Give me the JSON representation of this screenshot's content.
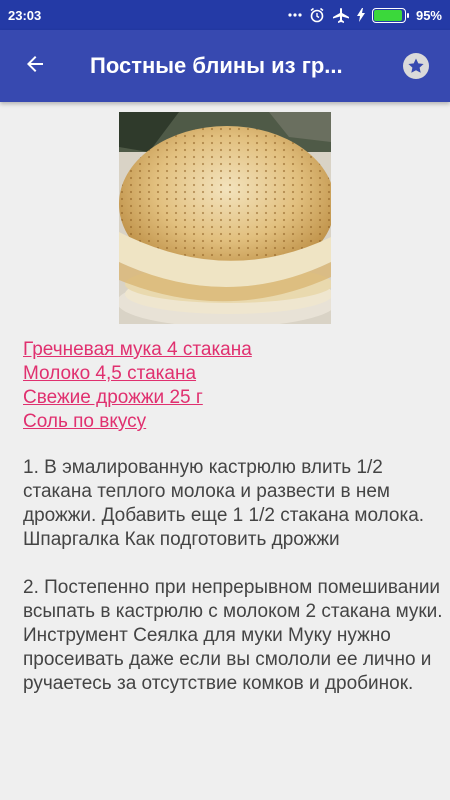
{
  "status_bar": {
    "time": "23:03",
    "battery_percent": "95%",
    "battery_level": 0.95,
    "icons": [
      "more-dots-icon",
      "alarm-icon",
      "airplane-mode-icon",
      "charging-bolt-icon",
      "battery-icon"
    ]
  },
  "app_bar": {
    "title": "Постные блины из гр...",
    "back_icon": "arrow-left-icon",
    "favorite_icon": "star-icon"
  },
  "recipe": {
    "image_alt": "pancakes-photo",
    "ingredients": [
      "Гречневая мука 4 стакана",
      "Молоко 4,5 стакана",
      "Свежие дрожжи 25 г",
      "Соль по вкусу"
    ],
    "steps": [
      "1. В эмалированную кастрюлю влить 1/2 стакана теплого молока и развести в нем дрожжи. Добавить еще 1 1/2 стакана молока. Шпаргалка Как подготовить дрожжи",
      "2. Постепенно при непрерывном помешивании всыпать в кастрюлю с молоком 2 стакана муки. Инструмент Сеялка для муки Муку нужно просеивать даже если вы смололи ее лично и ручаетесь за отсутствие комков и дробинок."
    ]
  },
  "colors": {
    "status_bar": "#243aa6",
    "app_bar": "#3749b0",
    "link": "#e0306f",
    "body_text": "#444444",
    "background": "#efefef"
  }
}
